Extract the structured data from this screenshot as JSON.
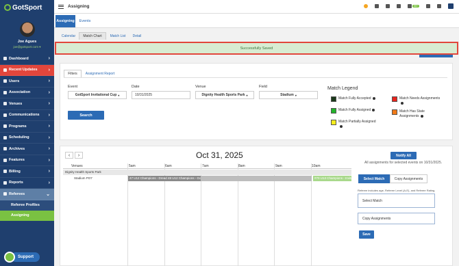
{
  "sidebar": {
    "logo": "GotSport",
    "user_name": "Joe Agues",
    "user_email": "joe@gotsport.com ▾",
    "items": [
      {
        "label": "Dashboard"
      },
      {
        "label": "Recent Updates"
      },
      {
        "label": "Users"
      },
      {
        "label": "Association"
      },
      {
        "label": "Venues"
      },
      {
        "label": "Communications"
      },
      {
        "label": "Programs"
      },
      {
        "label": "Scheduling"
      },
      {
        "label": "Archives"
      },
      {
        "label": "Features"
      },
      {
        "label": "Billing"
      },
      {
        "label": "Reports"
      },
      {
        "label": "Referees"
      }
    ],
    "sub_items": [
      {
        "label": "Referee Profiles"
      },
      {
        "label": "Assigning"
      }
    ],
    "support_label": "Support"
  },
  "topbar": {
    "title": "Assigning",
    "badge": "99+"
  },
  "tabs": {
    "primary": [
      "Assigning",
      "Events"
    ],
    "secondary": [
      "Calendar",
      "Match Chart",
      "Match List",
      "Detail"
    ]
  },
  "alert": "Successfully Saved",
  "filters": {
    "tabs": [
      "Filters",
      "Assignment Report"
    ],
    "event_label": "Event",
    "event_value": "GotSport Invitational Cup",
    "date_label": "Date",
    "date_value": "10/31/2025",
    "venue_label": "Venue",
    "venue_value": "Dignity Health Sports Park",
    "field_label": "Field",
    "field_value": "Stadium",
    "search_label": "Search"
  },
  "legend": {
    "title": "Match Legend",
    "items": [
      {
        "label": "Match Fully Accepted",
        "color": "#1b3a1b"
      },
      {
        "label": "Match Needs Assignments",
        "color": "#e8241c"
      },
      {
        "label": "Match Fully Assigned",
        "color": "#22b42a"
      },
      {
        "label": "Match Has State Assignments",
        "color": "#f07a18"
      },
      {
        "label": "Match Partially Assigned",
        "color": "#f6ec1c"
      }
    ]
  },
  "chart": {
    "date": "Oct 31, 2025",
    "prev": "‹",
    "next": "›",
    "notify_label": "Notify All",
    "notify_note": "All assignments for selected events on 10/31/2025.",
    "venues_header": "Venues",
    "times": [
      "5am",
      "6am",
      "7am",
      "8am",
      "9am",
      "10am"
    ],
    "venue": "Dignity Health Sports Park",
    "field": "Stadium PO7",
    "match_dark": "47 U12 Champions - Dread 48 U12 Champions - GotS",
    "match_green": "#70 U13 Champions - Invitatio"
  },
  "panel": {
    "select_match_tab": "Select Match",
    "copy_assignments_tab": "Copy Assignments",
    "note": "Referee includes age, Referee Level (A-E), and Referee Rating.",
    "select_match_placeholder": "Select Match",
    "copy_assignments_placeholder": "Copy Assignments",
    "save_label": "Save"
  }
}
